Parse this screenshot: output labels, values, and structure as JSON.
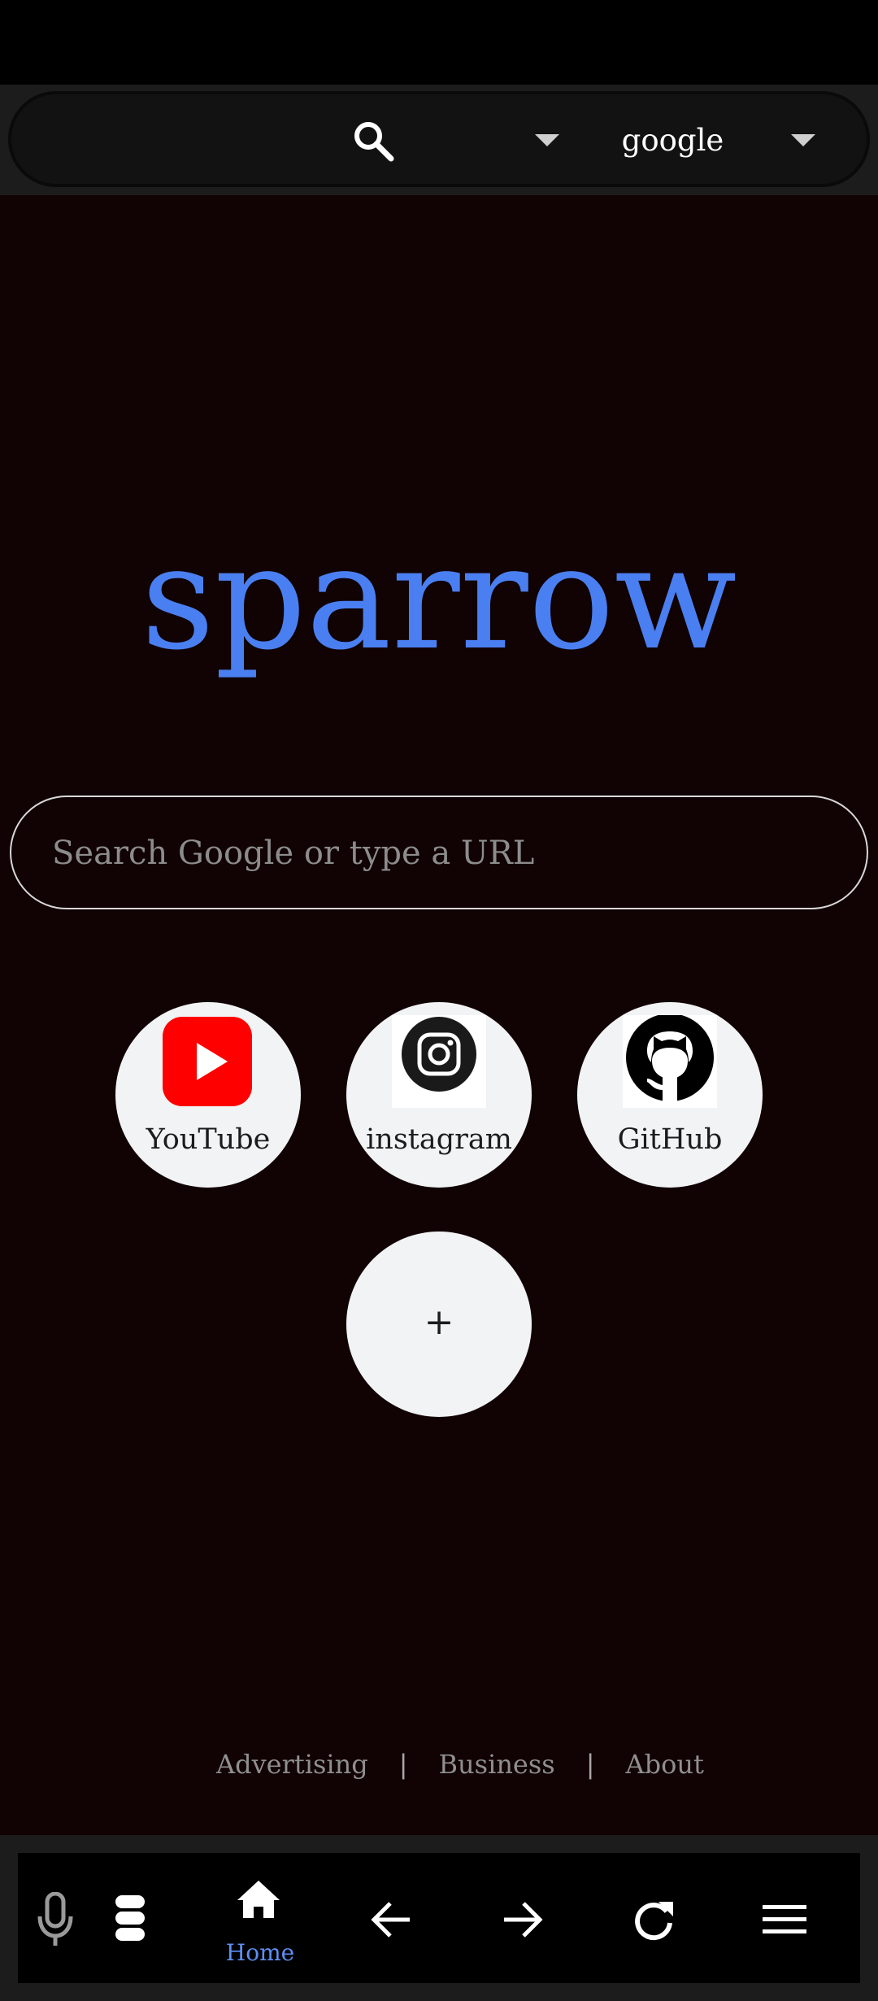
{
  "top_bar": {
    "engine_label": "google",
    "search_icon": "search-icon",
    "dropdown_icon": "caret-down-icon"
  },
  "brand": {
    "title": "sparrow",
    "color": "#4a7ff1"
  },
  "search": {
    "placeholder": "Search Google or type a URL"
  },
  "shortcuts": [
    {
      "label": "YouTube",
      "icon": "youtube-icon"
    },
    {
      "label": "instagram",
      "icon": "instagram-icon"
    },
    {
      "label": "GitHub",
      "icon": "github-icon"
    }
  ],
  "add_shortcut": {
    "label": "+"
  },
  "footer": {
    "links": [
      "Advertising",
      "Business",
      "About"
    ],
    "separator": "|"
  },
  "bottom_nav": {
    "items": [
      {
        "icon": "microphone-icon"
      },
      {
        "icon": "stack-icon"
      },
      {
        "icon": "home-icon",
        "label": "Home",
        "active": true
      },
      {
        "icon": "arrow-left-icon"
      },
      {
        "icon": "arrow-right-icon"
      },
      {
        "icon": "refresh-icon"
      },
      {
        "icon": "menu-icon"
      }
    ],
    "active_color": "#5d8ff5"
  }
}
